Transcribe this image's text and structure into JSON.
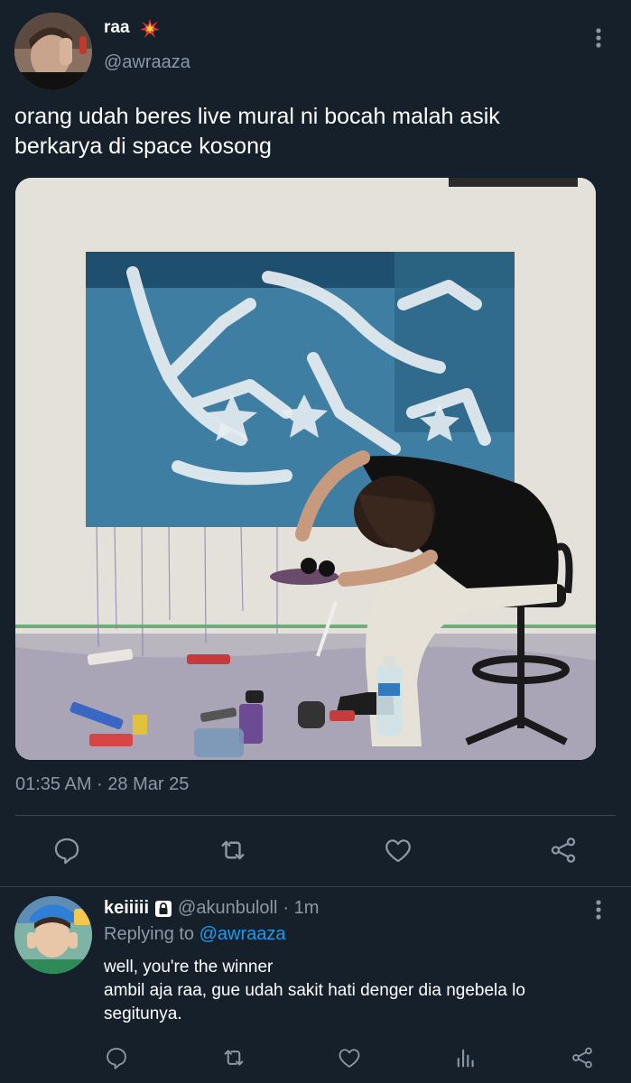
{
  "tweet": {
    "display_name": "raa",
    "handle": "@awraaza",
    "text_line1": "orang udah beres live mural ni bocah malah asik",
    "text_line2": "berkarya di space kosong",
    "timestamp": "01:35 AM · 28 Mar 25"
  },
  "actions": [
    "reply-icon",
    "retweet-icon",
    "like-icon",
    "share-icon"
  ],
  "reply": {
    "display_name": "keiiiii",
    "handle": "@akunbuloll",
    "time": "· 1m",
    "replying_prefix": "Replying to",
    "replying_to": "@awraaza",
    "text_line1": "well, you're the winner",
    "text_line2": "ambil aja raa, gue udah sakit hati denger dia ngebela lo",
    "text_line3": "segitunya.",
    "actions": [
      "reply-icon",
      "retweet-icon",
      "like-icon",
      "analytics-icon",
      "share-icon"
    ]
  },
  "colors": {
    "background": "#15202b",
    "secondary_text": "#8b98a5",
    "link": "#1d9bf0",
    "divider": "#38444d"
  }
}
